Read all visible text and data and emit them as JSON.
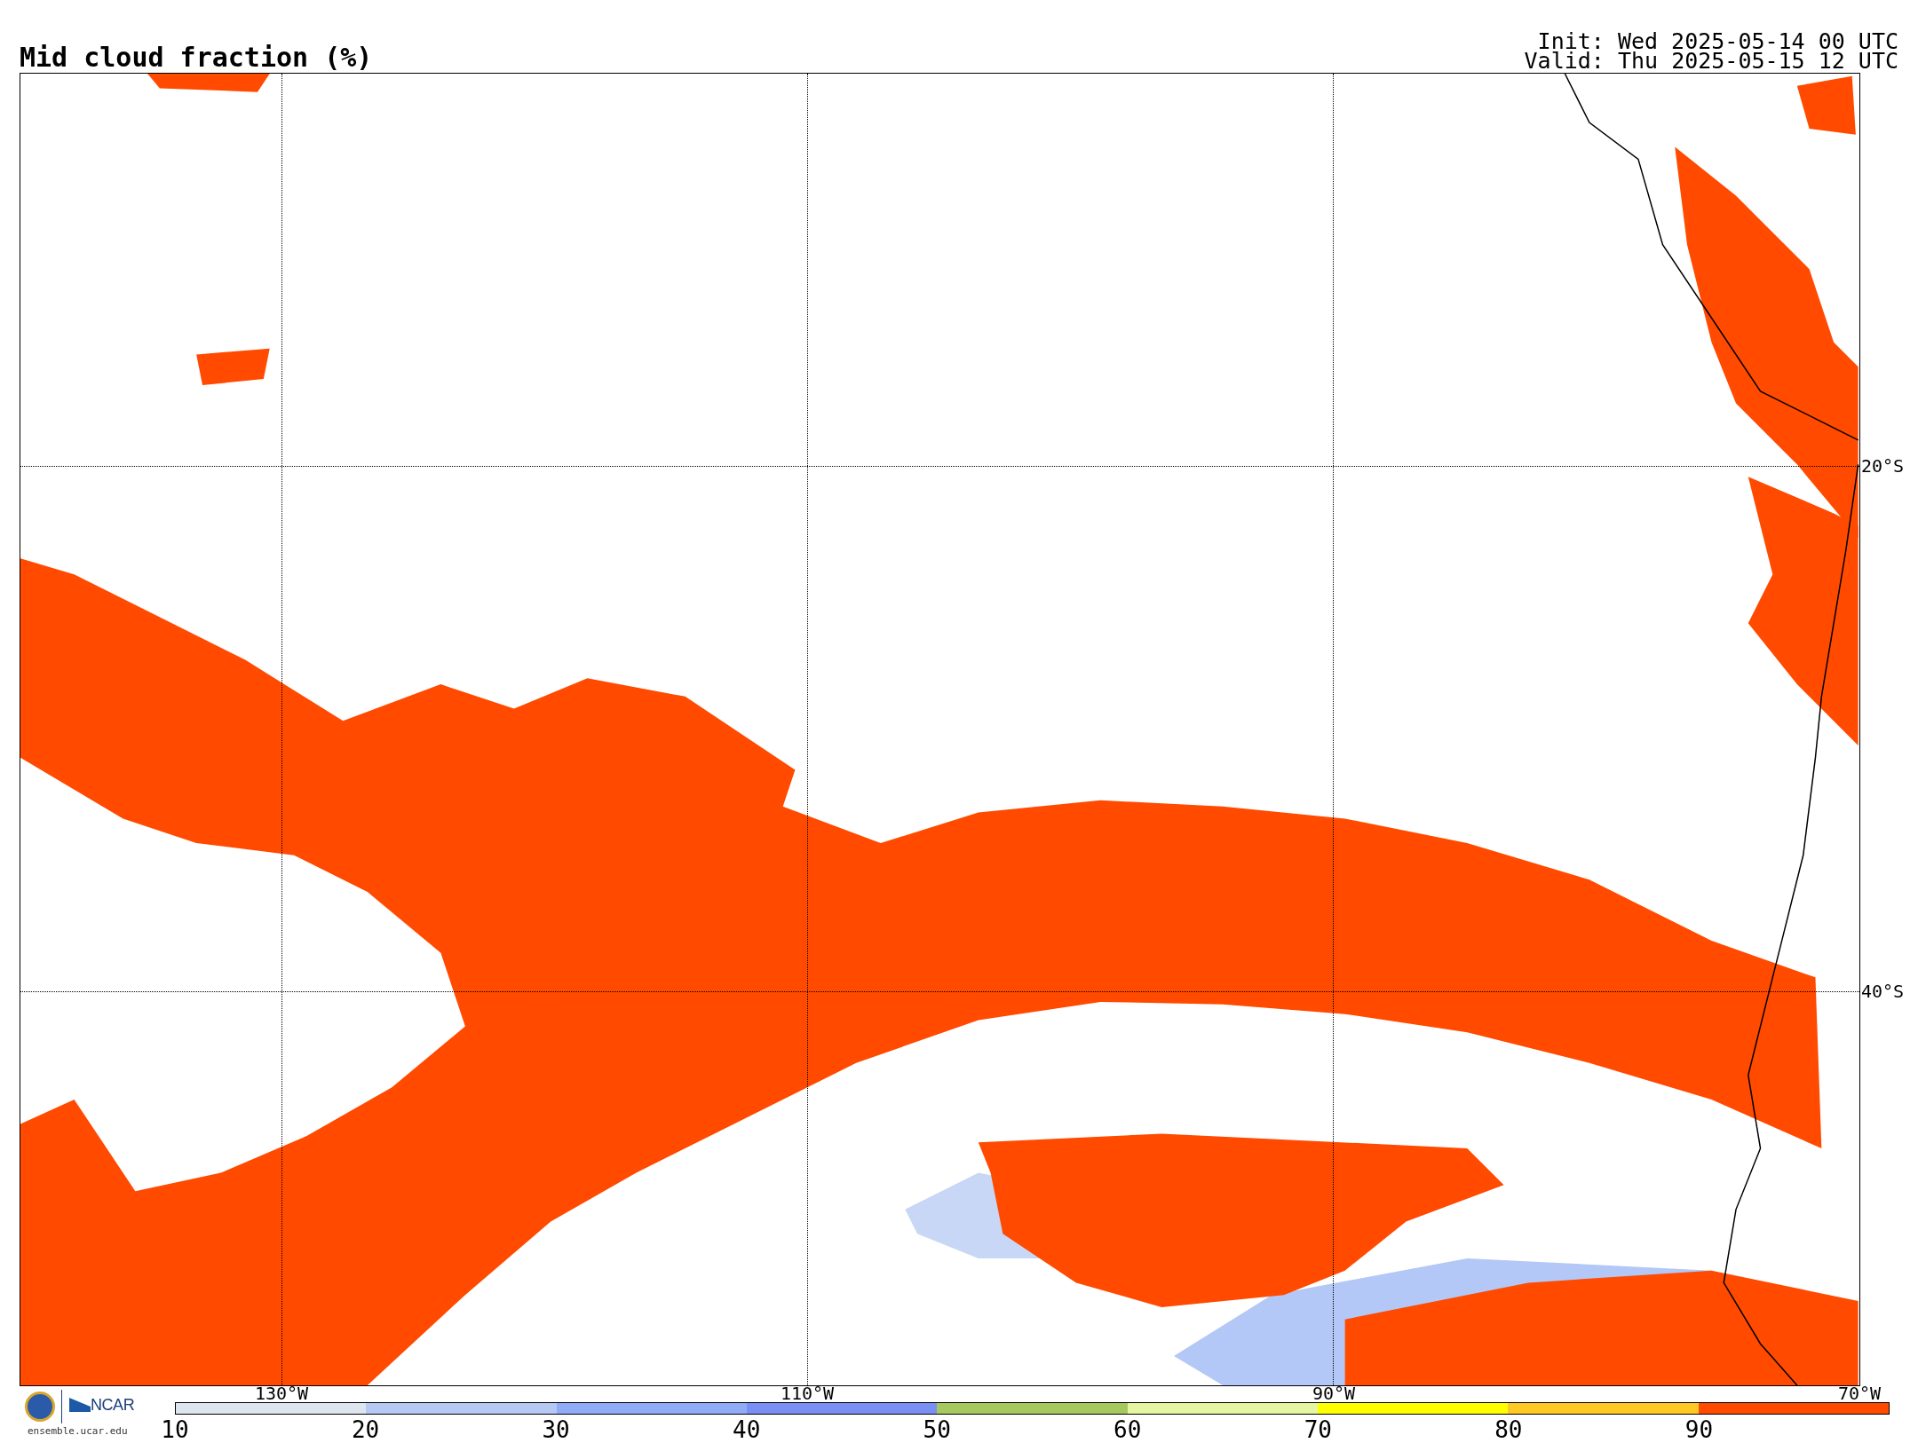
{
  "title": "Mid cloud fraction (%)",
  "init": "Init: Wed 2025-05-14 00 UTC",
  "valid": "Valid: Thu 2025-05-15 12 UTC",
  "map": {
    "longitude_labels": [
      "130°W",
      "110°W",
      "90°W",
      "70°W"
    ],
    "latitude_labels": [
      "20°S",
      "40°S"
    ]
  },
  "logo": {
    "org": "NCAR",
    "url": "ensemble.ucar.edu"
  },
  "colorbar": {
    "segments": [
      {
        "color": "#dde6ee"
      },
      {
        "color": "#b6c9f5"
      },
      {
        "color": "#90acf6"
      },
      {
        "color": "#7a8ff4"
      },
      {
        "color": "#a6c95f"
      },
      {
        "color": "#e6f5a2"
      },
      {
        "color": "#ffff00"
      },
      {
        "color": "#ffc924"
      },
      {
        "color": "#ff4a00"
      }
    ],
    "ticks": [
      "10",
      "20",
      "30",
      "40",
      "50",
      "60",
      "70",
      "80",
      "90"
    ]
  }
}
